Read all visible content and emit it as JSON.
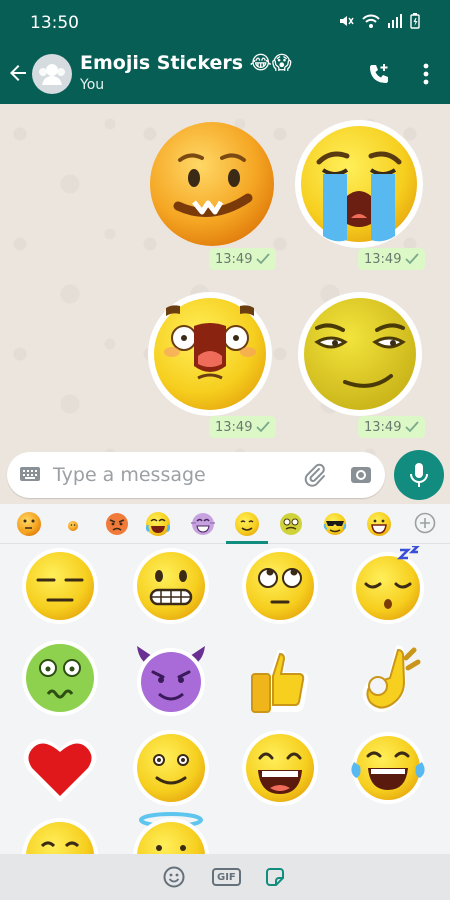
{
  "status_bar": {
    "time": "13:50"
  },
  "chat": {
    "title": "Emojis Stickers 😂😱",
    "subtitle": "You"
  },
  "messages": [
    {
      "time": "13:49",
      "sticker": "lip-bite-emoji"
    },
    {
      "time": "13:49",
      "sticker": "crying-emoji"
    },
    {
      "time": "13:49",
      "sticker": "shocked-emoji"
    },
    {
      "time": "13:49",
      "sticker": "smirk-emoji"
    }
  ],
  "input": {
    "placeholder": "Type a message"
  },
  "sticker_packs": [
    "thinking-pack",
    "small-pack",
    "angry-pack",
    "laughing-pack",
    "purple-laugh-pack",
    "smile-pack",
    "nauseated-pack",
    "cool-pack",
    "grin-pack"
  ],
  "bottom_bar": {
    "gif_label": "GIF"
  },
  "colors": {
    "header": "#075e54",
    "accent": "#128c7e",
    "bubble": "#dcf8c6",
    "chat_bg": "#ece5dd"
  }
}
